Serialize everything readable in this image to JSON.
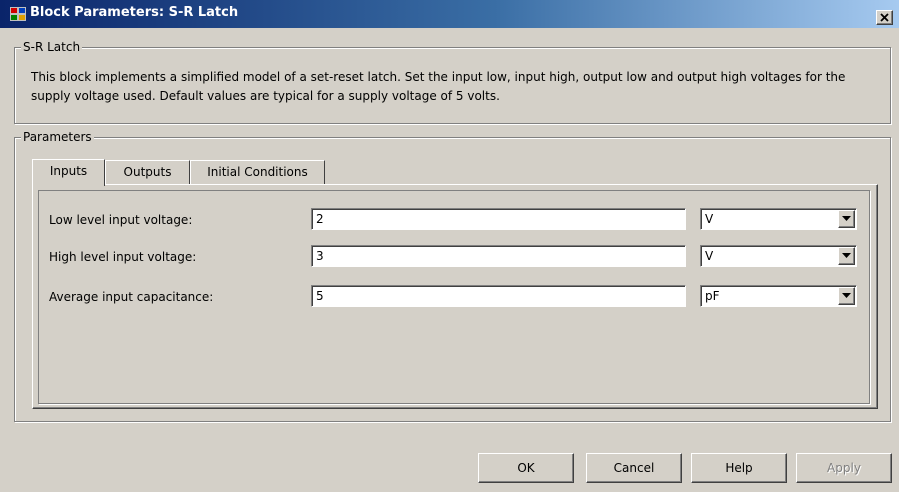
{
  "window": {
    "title": "Block Parameters: S-R Latch"
  },
  "block_group": {
    "title": "S-R Latch",
    "description": "This block implements a simplified model of a set-reset latch. Set the input low, input high, output low and output high voltages for the supply voltage used. Default values are typical for a supply voltage of 5 volts."
  },
  "parameters_group": {
    "title": "Parameters",
    "tabs": [
      {
        "label": "Inputs",
        "active": true
      },
      {
        "label": "Outputs",
        "active": false
      },
      {
        "label": "Initial Conditions",
        "active": false
      }
    ],
    "rows": [
      {
        "label": "Low level input voltage:",
        "value": "2",
        "unit": "V"
      },
      {
        "label": "High level input voltage:",
        "value": "3",
        "unit": "V"
      },
      {
        "label": "Average input capacitance:",
        "value": "5",
        "unit": "pF"
      }
    ]
  },
  "buttons": {
    "ok": "OK",
    "cancel": "Cancel",
    "help": "Help",
    "apply": "Apply"
  },
  "icons": {
    "app": "simulink-block-icon",
    "close": "close-icon",
    "dropdown": "chevron-down-icon"
  }
}
